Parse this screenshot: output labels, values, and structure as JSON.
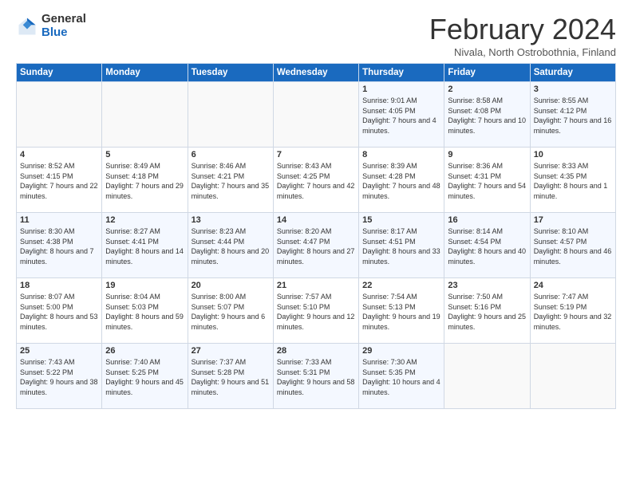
{
  "header": {
    "logo_general": "General",
    "logo_blue": "Blue",
    "title": "February 2024",
    "subtitle": "Nivala, North Ostrobothnia, Finland"
  },
  "days_of_week": [
    "Sunday",
    "Monday",
    "Tuesday",
    "Wednesday",
    "Thursday",
    "Friday",
    "Saturday"
  ],
  "weeks": [
    [
      {
        "num": "",
        "sunrise": "",
        "sunset": "",
        "daylight": ""
      },
      {
        "num": "",
        "sunrise": "",
        "sunset": "",
        "daylight": ""
      },
      {
        "num": "",
        "sunrise": "",
        "sunset": "",
        "daylight": ""
      },
      {
        "num": "",
        "sunrise": "",
        "sunset": "",
        "daylight": ""
      },
      {
        "num": "1",
        "sunrise": "Sunrise: 9:01 AM",
        "sunset": "Sunset: 4:05 PM",
        "daylight": "Daylight: 7 hours and 4 minutes."
      },
      {
        "num": "2",
        "sunrise": "Sunrise: 8:58 AM",
        "sunset": "Sunset: 4:08 PM",
        "daylight": "Daylight: 7 hours and 10 minutes."
      },
      {
        "num": "3",
        "sunrise": "Sunrise: 8:55 AM",
        "sunset": "Sunset: 4:12 PM",
        "daylight": "Daylight: 7 hours and 16 minutes."
      }
    ],
    [
      {
        "num": "4",
        "sunrise": "Sunrise: 8:52 AM",
        "sunset": "Sunset: 4:15 PM",
        "daylight": "Daylight: 7 hours and 22 minutes."
      },
      {
        "num": "5",
        "sunrise": "Sunrise: 8:49 AM",
        "sunset": "Sunset: 4:18 PM",
        "daylight": "Daylight: 7 hours and 29 minutes."
      },
      {
        "num": "6",
        "sunrise": "Sunrise: 8:46 AM",
        "sunset": "Sunset: 4:21 PM",
        "daylight": "Daylight: 7 hours and 35 minutes."
      },
      {
        "num": "7",
        "sunrise": "Sunrise: 8:43 AM",
        "sunset": "Sunset: 4:25 PM",
        "daylight": "Daylight: 7 hours and 42 minutes."
      },
      {
        "num": "8",
        "sunrise": "Sunrise: 8:39 AM",
        "sunset": "Sunset: 4:28 PM",
        "daylight": "Daylight: 7 hours and 48 minutes."
      },
      {
        "num": "9",
        "sunrise": "Sunrise: 8:36 AM",
        "sunset": "Sunset: 4:31 PM",
        "daylight": "Daylight: 7 hours and 54 minutes."
      },
      {
        "num": "10",
        "sunrise": "Sunrise: 8:33 AM",
        "sunset": "Sunset: 4:35 PM",
        "daylight": "Daylight: 8 hours and 1 minute."
      }
    ],
    [
      {
        "num": "11",
        "sunrise": "Sunrise: 8:30 AM",
        "sunset": "Sunset: 4:38 PM",
        "daylight": "Daylight: 8 hours and 7 minutes."
      },
      {
        "num": "12",
        "sunrise": "Sunrise: 8:27 AM",
        "sunset": "Sunset: 4:41 PM",
        "daylight": "Daylight: 8 hours and 14 minutes."
      },
      {
        "num": "13",
        "sunrise": "Sunrise: 8:23 AM",
        "sunset": "Sunset: 4:44 PM",
        "daylight": "Daylight: 8 hours and 20 minutes."
      },
      {
        "num": "14",
        "sunrise": "Sunrise: 8:20 AM",
        "sunset": "Sunset: 4:47 PM",
        "daylight": "Daylight: 8 hours and 27 minutes."
      },
      {
        "num": "15",
        "sunrise": "Sunrise: 8:17 AM",
        "sunset": "Sunset: 4:51 PM",
        "daylight": "Daylight: 8 hours and 33 minutes."
      },
      {
        "num": "16",
        "sunrise": "Sunrise: 8:14 AM",
        "sunset": "Sunset: 4:54 PM",
        "daylight": "Daylight: 8 hours and 40 minutes."
      },
      {
        "num": "17",
        "sunrise": "Sunrise: 8:10 AM",
        "sunset": "Sunset: 4:57 PM",
        "daylight": "Daylight: 8 hours and 46 minutes."
      }
    ],
    [
      {
        "num": "18",
        "sunrise": "Sunrise: 8:07 AM",
        "sunset": "Sunset: 5:00 PM",
        "daylight": "Daylight: 8 hours and 53 minutes."
      },
      {
        "num": "19",
        "sunrise": "Sunrise: 8:04 AM",
        "sunset": "Sunset: 5:03 PM",
        "daylight": "Daylight: 8 hours and 59 minutes."
      },
      {
        "num": "20",
        "sunrise": "Sunrise: 8:00 AM",
        "sunset": "Sunset: 5:07 PM",
        "daylight": "Daylight: 9 hours and 6 minutes."
      },
      {
        "num": "21",
        "sunrise": "Sunrise: 7:57 AM",
        "sunset": "Sunset: 5:10 PM",
        "daylight": "Daylight: 9 hours and 12 minutes."
      },
      {
        "num": "22",
        "sunrise": "Sunrise: 7:54 AM",
        "sunset": "Sunset: 5:13 PM",
        "daylight": "Daylight: 9 hours and 19 minutes."
      },
      {
        "num": "23",
        "sunrise": "Sunrise: 7:50 AM",
        "sunset": "Sunset: 5:16 PM",
        "daylight": "Daylight: 9 hours and 25 minutes."
      },
      {
        "num": "24",
        "sunrise": "Sunrise: 7:47 AM",
        "sunset": "Sunset: 5:19 PM",
        "daylight": "Daylight: 9 hours and 32 minutes."
      }
    ],
    [
      {
        "num": "25",
        "sunrise": "Sunrise: 7:43 AM",
        "sunset": "Sunset: 5:22 PM",
        "daylight": "Daylight: 9 hours and 38 minutes."
      },
      {
        "num": "26",
        "sunrise": "Sunrise: 7:40 AM",
        "sunset": "Sunset: 5:25 PM",
        "daylight": "Daylight: 9 hours and 45 minutes."
      },
      {
        "num": "27",
        "sunrise": "Sunrise: 7:37 AM",
        "sunset": "Sunset: 5:28 PM",
        "daylight": "Daylight: 9 hours and 51 minutes."
      },
      {
        "num": "28",
        "sunrise": "Sunrise: 7:33 AM",
        "sunset": "Sunset: 5:31 PM",
        "daylight": "Daylight: 9 hours and 58 minutes."
      },
      {
        "num": "29",
        "sunrise": "Sunrise: 7:30 AM",
        "sunset": "Sunset: 5:35 PM",
        "daylight": "Daylight: 10 hours and 4 minutes."
      },
      {
        "num": "",
        "sunrise": "",
        "sunset": "",
        "daylight": ""
      },
      {
        "num": "",
        "sunrise": "",
        "sunset": "",
        "daylight": ""
      }
    ]
  ]
}
